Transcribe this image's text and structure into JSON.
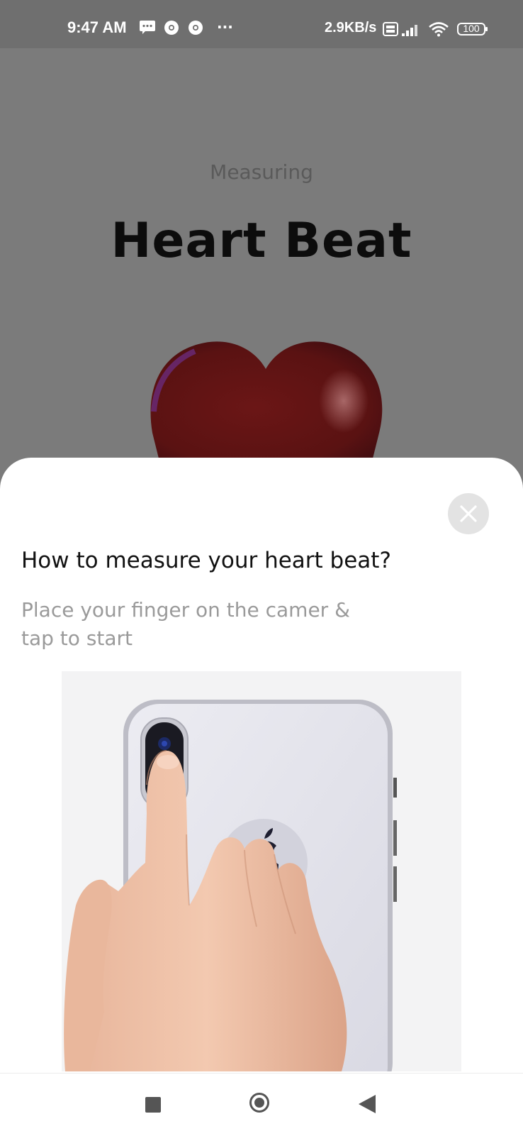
{
  "status_bar": {
    "time": "9:47 AM",
    "network_speed": "2.9KB/s",
    "battery": "100",
    "more": "···"
  },
  "background": {
    "subtitle": "Measuring",
    "title": "Heart Beat"
  },
  "sheet": {
    "title": "How to measure your heart beat?",
    "description": "Place your finger on the camer & tap to start"
  },
  "icons": {
    "message": "message-icon",
    "chrome": "chrome-icon",
    "signal": "signal-icon",
    "wifi": "wifi-icon",
    "close": "close-icon",
    "nav_recents": "square-icon",
    "nav_home": "circle-icon",
    "nav_back": "triangle-back-icon"
  }
}
